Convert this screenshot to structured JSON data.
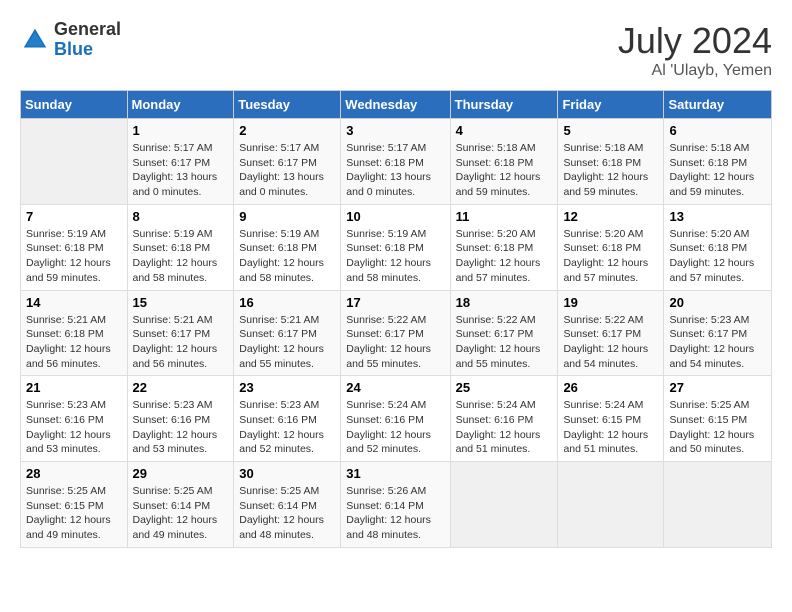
{
  "header": {
    "logo_general": "General",
    "logo_blue": "Blue",
    "month_year": "July 2024",
    "location": "Al 'Ulayb, Yemen"
  },
  "calendar": {
    "days_of_week": [
      "Sunday",
      "Monday",
      "Tuesday",
      "Wednesday",
      "Thursday",
      "Friday",
      "Saturday"
    ],
    "weeks": [
      [
        {
          "day": "",
          "info": ""
        },
        {
          "day": "1",
          "info": "Sunrise: 5:17 AM\nSunset: 6:17 PM\nDaylight: 13 hours\nand 0 minutes."
        },
        {
          "day": "2",
          "info": "Sunrise: 5:17 AM\nSunset: 6:17 PM\nDaylight: 13 hours\nand 0 minutes."
        },
        {
          "day": "3",
          "info": "Sunrise: 5:17 AM\nSunset: 6:18 PM\nDaylight: 13 hours\nand 0 minutes."
        },
        {
          "day": "4",
          "info": "Sunrise: 5:18 AM\nSunset: 6:18 PM\nDaylight: 12 hours\nand 59 minutes."
        },
        {
          "day": "5",
          "info": "Sunrise: 5:18 AM\nSunset: 6:18 PM\nDaylight: 12 hours\nand 59 minutes."
        },
        {
          "day": "6",
          "info": "Sunrise: 5:18 AM\nSunset: 6:18 PM\nDaylight: 12 hours\nand 59 minutes."
        }
      ],
      [
        {
          "day": "7",
          "info": "Sunrise: 5:19 AM\nSunset: 6:18 PM\nDaylight: 12 hours\nand 59 minutes."
        },
        {
          "day": "8",
          "info": "Sunrise: 5:19 AM\nSunset: 6:18 PM\nDaylight: 12 hours\nand 58 minutes."
        },
        {
          "day": "9",
          "info": "Sunrise: 5:19 AM\nSunset: 6:18 PM\nDaylight: 12 hours\nand 58 minutes."
        },
        {
          "day": "10",
          "info": "Sunrise: 5:19 AM\nSunset: 6:18 PM\nDaylight: 12 hours\nand 58 minutes."
        },
        {
          "day": "11",
          "info": "Sunrise: 5:20 AM\nSunset: 6:18 PM\nDaylight: 12 hours\nand 57 minutes."
        },
        {
          "day": "12",
          "info": "Sunrise: 5:20 AM\nSunset: 6:18 PM\nDaylight: 12 hours\nand 57 minutes."
        },
        {
          "day": "13",
          "info": "Sunrise: 5:20 AM\nSunset: 6:18 PM\nDaylight: 12 hours\nand 57 minutes."
        }
      ],
      [
        {
          "day": "14",
          "info": "Sunrise: 5:21 AM\nSunset: 6:18 PM\nDaylight: 12 hours\nand 56 minutes."
        },
        {
          "day": "15",
          "info": "Sunrise: 5:21 AM\nSunset: 6:17 PM\nDaylight: 12 hours\nand 56 minutes."
        },
        {
          "day": "16",
          "info": "Sunrise: 5:21 AM\nSunset: 6:17 PM\nDaylight: 12 hours\nand 55 minutes."
        },
        {
          "day": "17",
          "info": "Sunrise: 5:22 AM\nSunset: 6:17 PM\nDaylight: 12 hours\nand 55 minutes."
        },
        {
          "day": "18",
          "info": "Sunrise: 5:22 AM\nSunset: 6:17 PM\nDaylight: 12 hours\nand 55 minutes."
        },
        {
          "day": "19",
          "info": "Sunrise: 5:22 AM\nSunset: 6:17 PM\nDaylight: 12 hours\nand 54 minutes."
        },
        {
          "day": "20",
          "info": "Sunrise: 5:23 AM\nSunset: 6:17 PM\nDaylight: 12 hours\nand 54 minutes."
        }
      ],
      [
        {
          "day": "21",
          "info": "Sunrise: 5:23 AM\nSunset: 6:16 PM\nDaylight: 12 hours\nand 53 minutes."
        },
        {
          "day": "22",
          "info": "Sunrise: 5:23 AM\nSunset: 6:16 PM\nDaylight: 12 hours\nand 53 minutes."
        },
        {
          "day": "23",
          "info": "Sunrise: 5:23 AM\nSunset: 6:16 PM\nDaylight: 12 hours\nand 52 minutes."
        },
        {
          "day": "24",
          "info": "Sunrise: 5:24 AM\nSunset: 6:16 PM\nDaylight: 12 hours\nand 52 minutes."
        },
        {
          "day": "25",
          "info": "Sunrise: 5:24 AM\nSunset: 6:16 PM\nDaylight: 12 hours\nand 51 minutes."
        },
        {
          "day": "26",
          "info": "Sunrise: 5:24 AM\nSunset: 6:15 PM\nDaylight: 12 hours\nand 51 minutes."
        },
        {
          "day": "27",
          "info": "Sunrise: 5:25 AM\nSunset: 6:15 PM\nDaylight: 12 hours\nand 50 minutes."
        }
      ],
      [
        {
          "day": "28",
          "info": "Sunrise: 5:25 AM\nSunset: 6:15 PM\nDaylight: 12 hours\nand 49 minutes."
        },
        {
          "day": "29",
          "info": "Sunrise: 5:25 AM\nSunset: 6:14 PM\nDaylight: 12 hours\nand 49 minutes."
        },
        {
          "day": "30",
          "info": "Sunrise: 5:25 AM\nSunset: 6:14 PM\nDaylight: 12 hours\nand 48 minutes."
        },
        {
          "day": "31",
          "info": "Sunrise: 5:26 AM\nSunset: 6:14 PM\nDaylight: 12 hours\nand 48 minutes."
        },
        {
          "day": "",
          "info": ""
        },
        {
          "day": "",
          "info": ""
        },
        {
          "day": "",
          "info": ""
        }
      ]
    ]
  }
}
